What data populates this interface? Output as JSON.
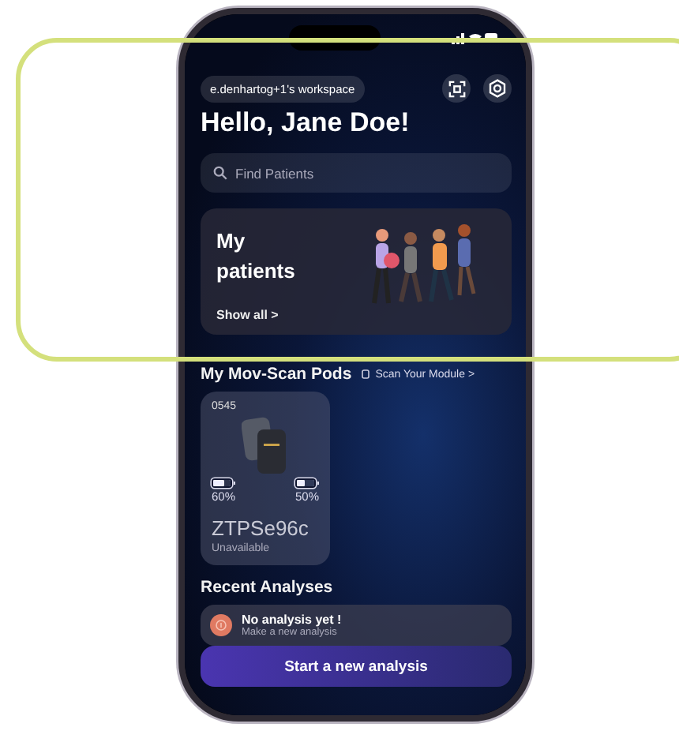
{
  "header": {
    "workspace": "e.denhartog+1's workspace"
  },
  "greeting": "Hello, Jane Doe!",
  "search": {
    "placeholder": "Find Patients"
  },
  "patients_card": {
    "title": "My patients",
    "link": "Show all >"
  },
  "pods_section": {
    "title": "My Mov-Scan Pods",
    "link": "Scan Your Module >"
  },
  "pods": [
    {
      "id": "0545",
      "batteries": [
        {
          "reading": "60%",
          "level": 0.6
        },
        {
          "reading": "50%",
          "level": 0.5
        }
      ],
      "name": "ZTPSe96c",
      "status": "Unavailable"
    }
  ],
  "recent": {
    "title": "Recent Analyses",
    "empty_title": "No analysis yet !",
    "empty_subtitle": "Make a new analysis"
  },
  "primary_button": "Start a new analysis"
}
